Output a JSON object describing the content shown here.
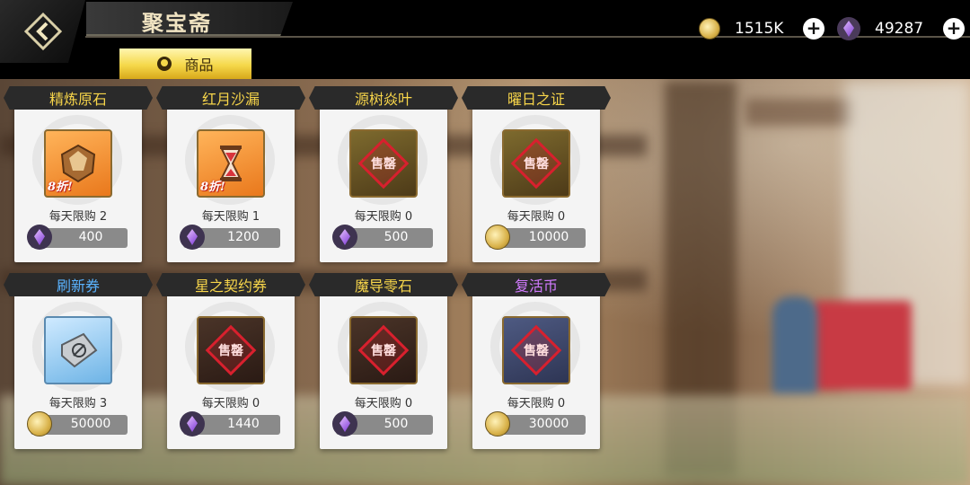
{
  "header": {
    "title": "聚宝斋",
    "tab_label": "商品",
    "coin_amount": "1515K",
    "gem_amount": "49287",
    "plus_symbol": "+"
  },
  "items": [
    {
      "name": "精炼原石",
      "limit": "每天限购 2",
      "price": "400",
      "currency": "gem",
      "discount": "8折!",
      "name_color": "gold"
    },
    {
      "name": "红月沙漏",
      "limit": "每天限购 1",
      "price": "1200",
      "currency": "gem",
      "discount": "8折!",
      "name_color": "gold"
    },
    {
      "name": "源树焱叶",
      "limit": "每天限购 0",
      "price": "500",
      "currency": "gem",
      "stamp": "售罄",
      "name_color": "gold"
    },
    {
      "name": "曜日之证",
      "limit": "每天限购 0",
      "price": "10000",
      "currency": "coin",
      "stamp": "售罄",
      "name_color": "gold"
    },
    {
      "name": "刷新券",
      "limit": "每天限购 3",
      "price": "50000",
      "currency": "coin",
      "name_color": "blue"
    },
    {
      "name": "星之契约券",
      "limit": "每天限购 0",
      "price": "1440",
      "currency": "gem",
      "stamp": "售罄",
      "name_color": "gold"
    },
    {
      "name": "魔导零石",
      "limit": "每天限购 0",
      "price": "500",
      "currency": "gem",
      "stamp": "售罄",
      "name_color": "gold"
    },
    {
      "name": "复活币",
      "limit": "每天限购 0",
      "price": "30000",
      "currency": "coin",
      "stamp": "售罄",
      "name_color": "violet"
    }
  ],
  "colors": {
    "name_gold": "#f7d54a",
    "name_blue": "#5ab3ff",
    "name_violet": "#d27bff",
    "tab_yellow": "#f5d84a"
  }
}
